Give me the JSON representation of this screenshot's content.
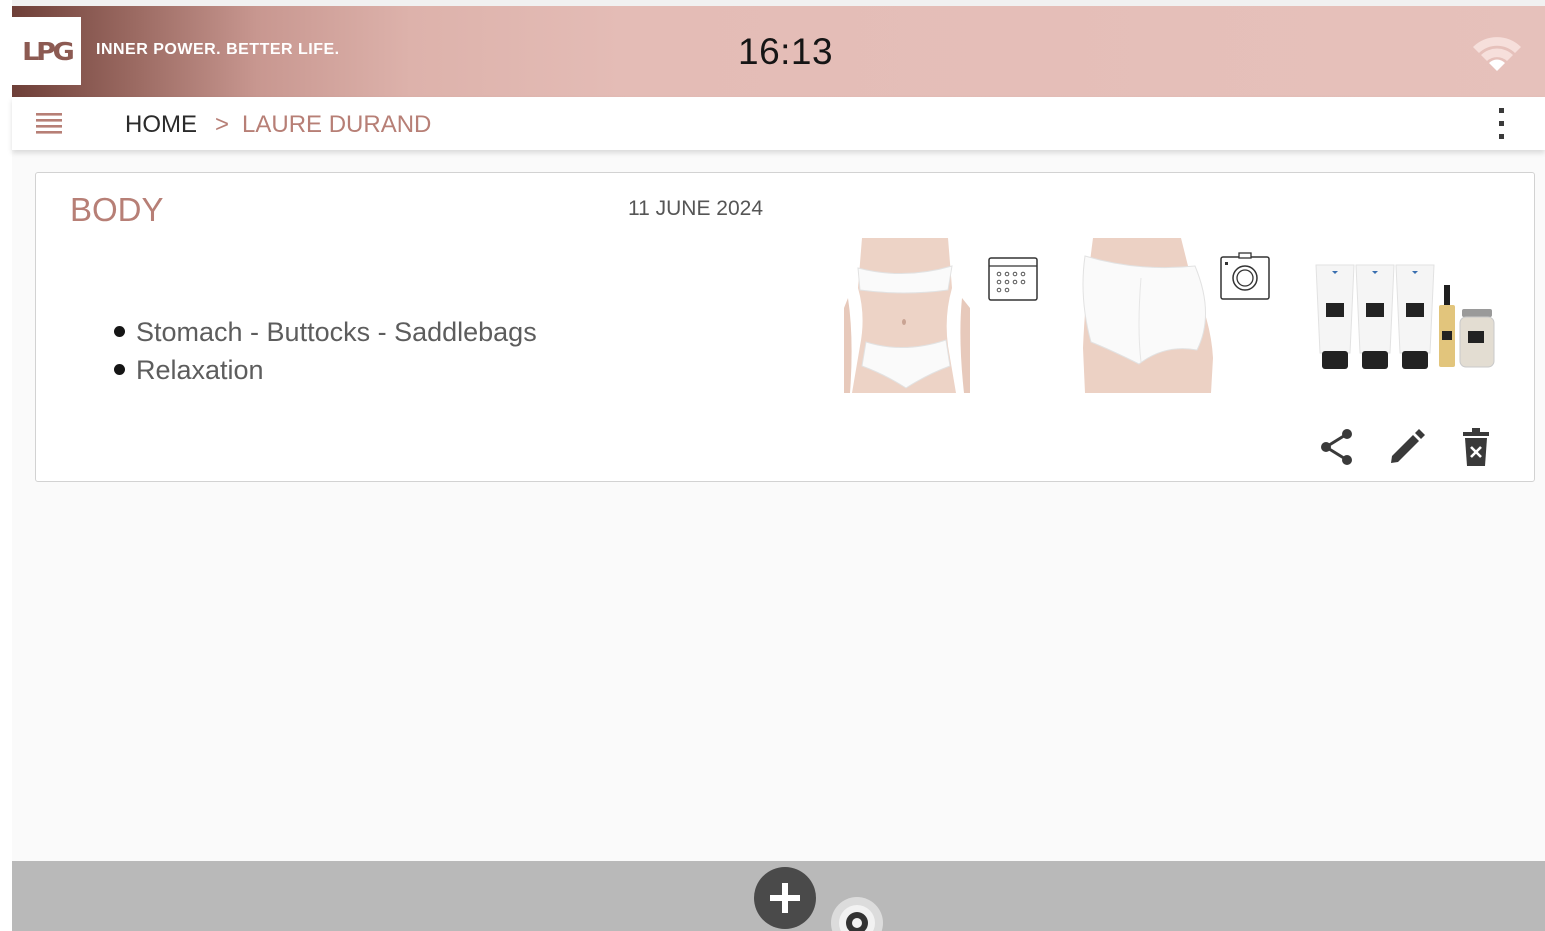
{
  "status_bar": {
    "logo_text": "LPG",
    "tagline": "INNER POWER. BETTER LIFE.",
    "time": "16:13",
    "wifi_icon": "wifi-icon"
  },
  "app_bar": {
    "menu_icon": "hamburger-menu-icon",
    "breadcrumb": {
      "home": "HOME",
      "separator": ">",
      "current": "LAURE DURAND"
    },
    "overflow_icon": "more-vertical-icon"
  },
  "session_card": {
    "title": "BODY",
    "date": "11 JUNE 2024",
    "zones": [
      "Stomach - Buttocks - Saddlebags",
      "Relaxation"
    ],
    "images": {
      "front": "body-front-photo",
      "back": "body-back-photo",
      "products": "lpg-products-image",
      "calendar_icon": "calendar-icon",
      "camera_icon": "camera-icon"
    },
    "actions": [
      "share-icon",
      "edit-pencil-icon",
      "delete-trash-icon"
    ]
  },
  "bottom_bar": {
    "add_icon": "add-icon",
    "assistive_icon": "assistive-touch-icon"
  },
  "colors": {
    "accent": "#b77f76",
    "header_dark": "#6e3f38",
    "header_light": "#e6c1bb",
    "bottom_bar": "#b9b9b9",
    "fab": "#4a4a4a"
  }
}
